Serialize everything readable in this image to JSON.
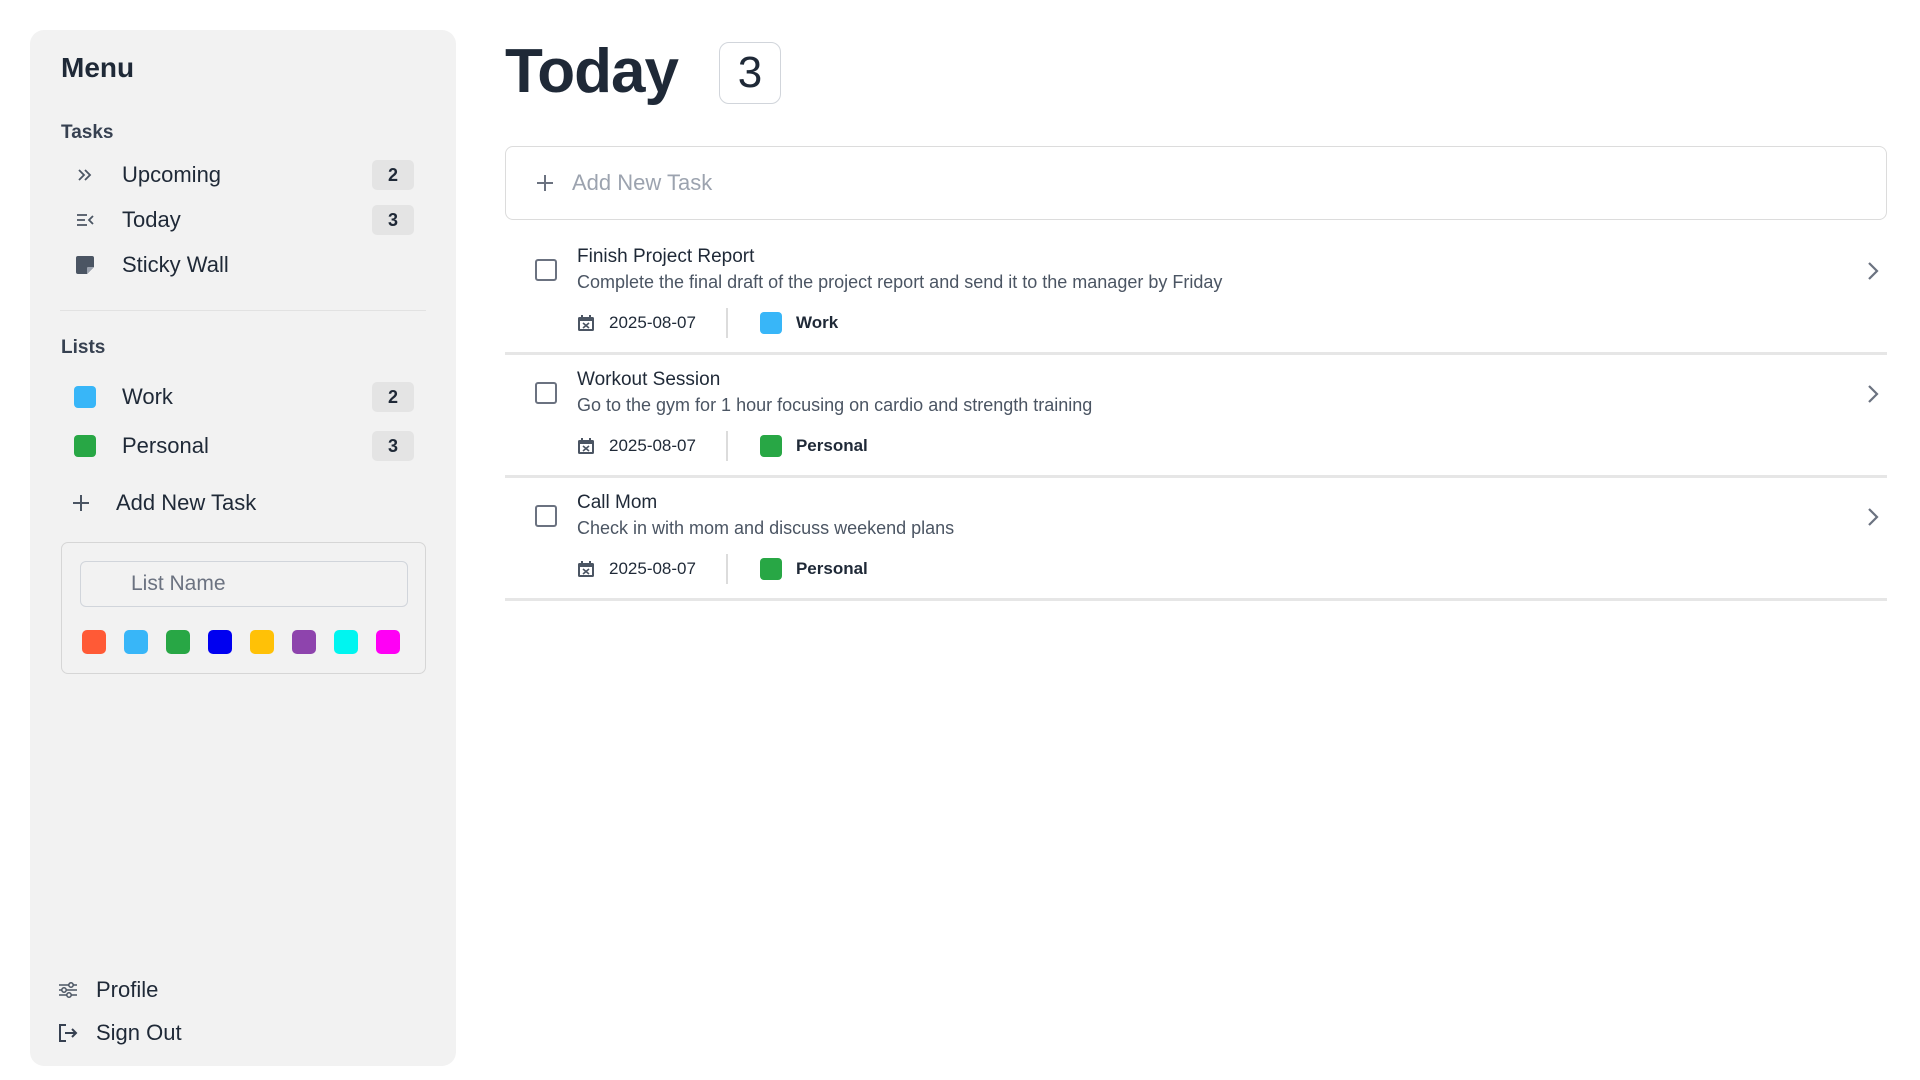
{
  "sidebar": {
    "title": "Menu",
    "tasks_label": "Tasks",
    "task_items": [
      {
        "label": "Upcoming",
        "count": "2",
        "icon": "double-chevron-right-icon"
      },
      {
        "label": "Today",
        "count": "3",
        "icon": "list-today-icon"
      },
      {
        "label": "Sticky Wall",
        "icon": "sticky-note-icon"
      }
    ],
    "lists_label": "Lists",
    "list_items": [
      {
        "label": "Work",
        "count": "2",
        "color": "#38b6f8"
      },
      {
        "label": "Personal",
        "count": "3",
        "color": "#28a745"
      }
    ],
    "add_new_task": "Add New Task",
    "list_form": {
      "placeholder": "List Name",
      "colors": [
        "#ff5a36",
        "#38b6f8",
        "#28a745",
        "#0000f0",
        "#ffc107",
        "#8e44ad",
        "#00f5f0",
        "#ff00f5"
      ]
    },
    "profile": "Profile",
    "sign_out": "Sign Out"
  },
  "main": {
    "title": "Today",
    "count": "3",
    "add_task_placeholder": "Add New Task",
    "tasks": [
      {
        "title": "Finish Project Report",
        "description": "Complete the final draft of the project report and send it to the manager by Friday",
        "date": "2025-08-07",
        "list": "Work",
        "list_color": "#38b6f8"
      },
      {
        "title": "Workout Session",
        "description": "Go to the gym for 1 hour focusing on cardio and strength training",
        "date": "2025-08-07",
        "list": "Personal",
        "list_color": "#28a745"
      },
      {
        "title": "Call Mom",
        "description": "Check in with mom and discuss weekend plans",
        "date": "2025-08-07",
        "list": "Personal",
        "list_color": "#28a745"
      }
    ]
  }
}
